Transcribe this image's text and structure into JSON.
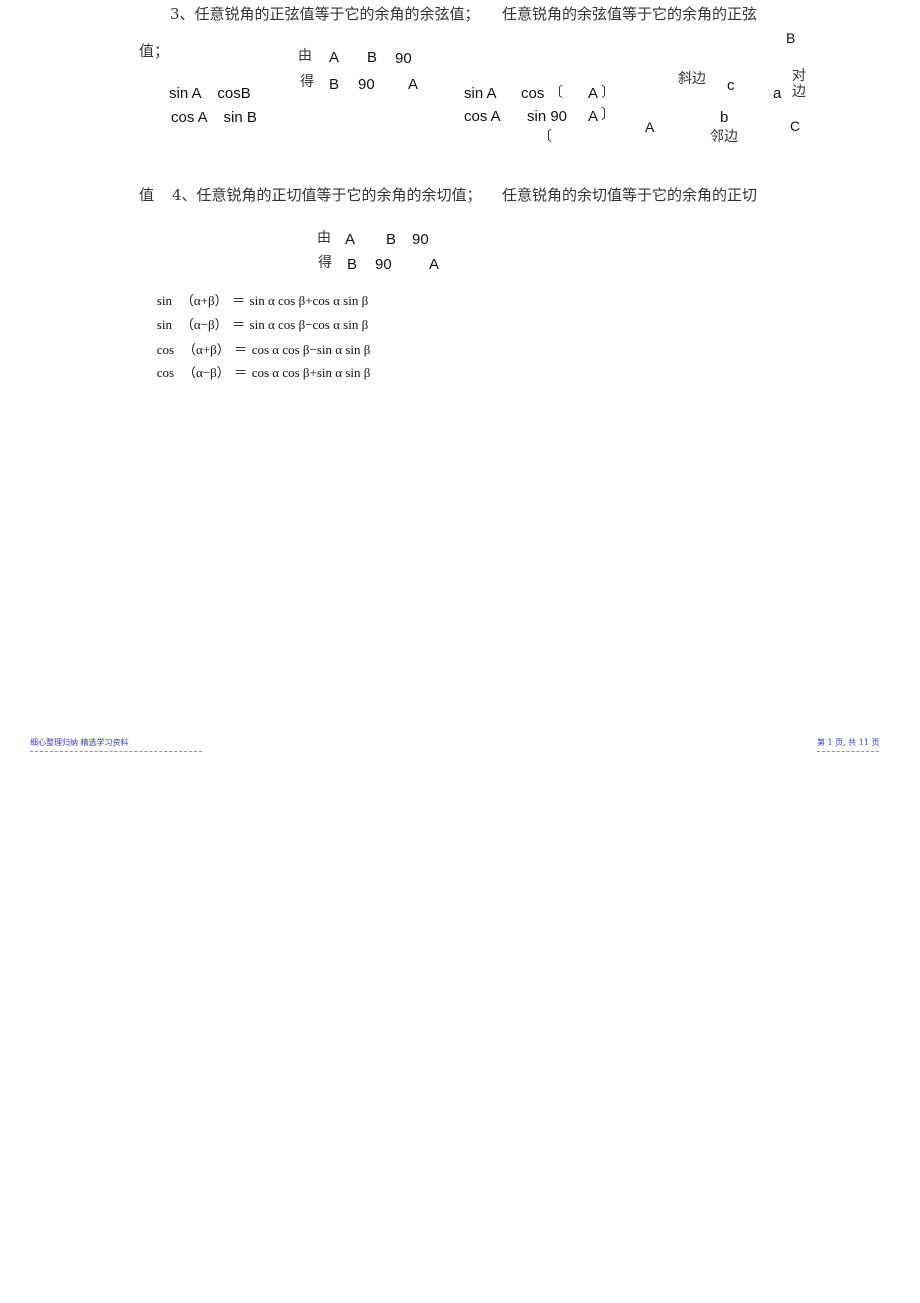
{
  "section3": {
    "heading": "3、任意锐角的正弦值等于它的余角的余弦值；",
    "heading2": "任意锐角的余弦值等于它的余角的正弦",
    "tail": "值；",
    "left_formulas": [
      "sin A    cosB",
      "cos A    sin B"
    ],
    "given": {
      "you": "由",
      "A": "A",
      "B": "B",
      "n90": "90"
    },
    "derive": {
      "de": "得",
      "B": "B",
      "n90": "90",
      "A": "A"
    },
    "right_formulas": {
      "row1": {
        "lhs": "sin A",
        "fn": "cos",
        "lbr": "〔",
        "arg": "A",
        "rbr": "〕"
      },
      "row2": {
        "lhs": "cos A",
        "fn": "sin 90",
        "arg": "A",
        "rbr": "〕"
      },
      "row3": {
        "lbr": "〔"
      }
    },
    "triangle": {
      "B": "B",
      "A": "A",
      "C": "C",
      "hyp_label": "斜边",
      "hyp": "c",
      "opp_label_1": "对",
      "opp_label_2": "边",
      "opp": "a",
      "adj": "b",
      "adj_label": "邻边"
    }
  },
  "section4": {
    "prefix": "值",
    "heading": "4、任意锐角的正切值等于它的余角的余切值；",
    "heading2": "任意锐角的余切值等于它的余角的正切",
    "given": {
      "you": "由",
      "A": "A",
      "B": "B",
      "n90": "90"
    },
    "derive": {
      "de": "得",
      "B": "B",
      "n90": "90",
      "A": "A"
    }
  },
  "identities": [
    {
      "fn": "sin",
      "arg": "（α+β）",
      "eq": "＝",
      "rhs": "sin α cos β+cos α sin β"
    },
    {
      "fn": "sin",
      "arg": "（α−β）",
      "eq": "＝",
      "rhs": "sin α cos β−cos α sin β"
    },
    {
      "fn": "cos",
      "arg": "（α+β）",
      "eq": "＝",
      "rhs": "cos α cos β−sin α sin β"
    },
    {
      "fn": "cos",
      "arg": "（α−β）",
      "eq": "＝",
      "rhs": "cos α cos β+sin α sin β"
    }
  ],
  "footer": {
    "left": "细心整理归纳    精选学习资料",
    "right": "第 1 页, 共 11 页"
  }
}
